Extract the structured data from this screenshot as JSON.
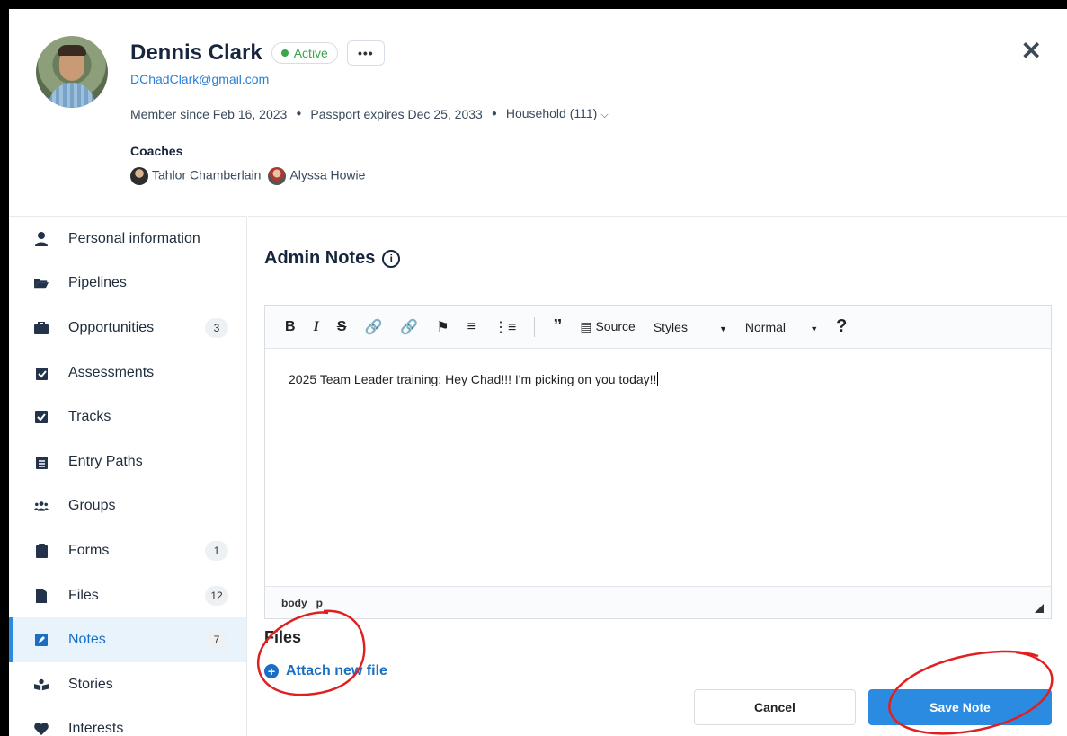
{
  "profile": {
    "name": "Dennis Clark",
    "status": "Active",
    "more_label": "•••",
    "email": "DChadClark@gmail.com",
    "member_since": "Member since Feb 16, 2023",
    "passport": "Passport expires Dec 25, 2033",
    "household": "Household (111)",
    "coaches_label": "Coaches",
    "coaches": [
      "Tahlor Chamberlain",
      "Alyssa Howie"
    ]
  },
  "sidebar": {
    "items": [
      {
        "label": "Personal information",
        "icon": "person-icon",
        "count": ""
      },
      {
        "label": "Pipelines",
        "icon": "folder-open-icon",
        "count": ""
      },
      {
        "label": "Opportunities",
        "icon": "briefcase-icon",
        "count": "3"
      },
      {
        "label": "Assessments",
        "icon": "clipboard-check-icon",
        "count": ""
      },
      {
        "label": "Tracks",
        "icon": "checkbox-icon",
        "count": ""
      },
      {
        "label": "Entry Paths",
        "icon": "clipboard-list-icon",
        "count": ""
      },
      {
        "label": "Groups",
        "icon": "users-icon",
        "count": ""
      },
      {
        "label": "Forms",
        "icon": "clipboard-icon",
        "count": "1"
      },
      {
        "label": "Files",
        "icon": "file-icon",
        "count": "12"
      },
      {
        "label": "Notes",
        "icon": "edit-icon",
        "count": "7"
      },
      {
        "label": "Stories",
        "icon": "book-reader-icon",
        "count": ""
      },
      {
        "label": "Interests",
        "icon": "heart-icon",
        "count": ""
      }
    ],
    "active": "Notes"
  },
  "main": {
    "title": "Admin Notes",
    "toolbar": {
      "bold": "B",
      "italic": "I",
      "strike": "S",
      "source": "Source",
      "styles": "Styles",
      "format": "Normal",
      "help": "?"
    },
    "note_text": "2025 Team Leader training: Hey Chad!!!  I'm picking on you today!!",
    "path": [
      "body",
      "p"
    ],
    "files_title": "Files",
    "attach_label": "Attach new file",
    "cancel_label": "Cancel",
    "save_label": "Save Note"
  },
  "colors": {
    "accent": "#2a8be0",
    "active_green": "#3ba54b",
    "annotation_red": "#e02020"
  }
}
